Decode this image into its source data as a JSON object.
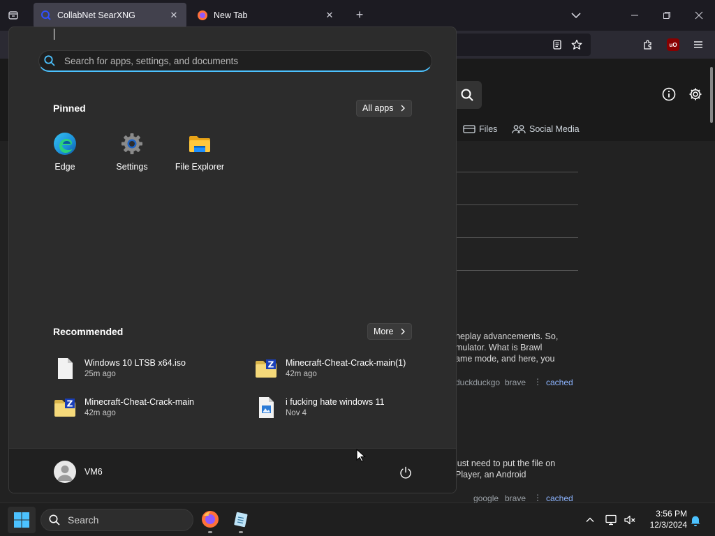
{
  "browser": {
    "tabs": [
      {
        "title": "CollabNet SearXNG",
        "active": true
      },
      {
        "title": "New Tab",
        "active": false
      }
    ]
  },
  "webpage": {
    "categories": [
      {
        "label": "Files",
        "icon": "files-icon"
      },
      {
        "label": "Social Media",
        "icon": "social-media-icon"
      }
    ],
    "results": [
      {
        "snippet": [
          "neplay advancements. So,",
          "mulator. What is Brawl",
          "ame mode, and here, you"
        ],
        "engines": [
          "duckduckgo",
          "brave"
        ],
        "cached": "cached"
      },
      {
        "snippet": [
          "just need to put the file on",
          "Player, an Android"
        ],
        "engines": [
          "google",
          "brave"
        ],
        "cached": "cached"
      }
    ]
  },
  "start_menu": {
    "search_placeholder": "Search for apps, settings, and documents",
    "pinned_title": "Pinned",
    "all_apps_label": "All apps",
    "pinned": [
      {
        "label": "Edge",
        "icon": "edge-icon"
      },
      {
        "label": "Settings",
        "icon": "settings-gear-icon"
      },
      {
        "label": "File Explorer",
        "icon": "folder-icon"
      }
    ],
    "recommended_title": "Recommended",
    "more_label": "More",
    "recommended": [
      {
        "name": "Windows 10 LTSB x64.iso",
        "time": "25m ago",
        "icon": "file-icon"
      },
      {
        "name": "Minecraft-Cheat-Crack-main(1)",
        "time": "42m ago",
        "icon": "zip-folder-icon"
      },
      {
        "name": "Minecraft-Cheat-Crack-main",
        "time": "42m ago",
        "icon": "zip-folder-icon"
      },
      {
        "name": "i fucking hate windows 11",
        "time": "Nov 4",
        "icon": "image-file-icon"
      }
    ],
    "user_name": "VM6"
  },
  "taskbar": {
    "search_label": "Search",
    "time": "3:56 PM",
    "date": "12/3/2024"
  },
  "colors": {
    "accent": "#4cc2ff",
    "link": "#8cb4ff",
    "start_bg": "#2c2c2c",
    "taskbar_bg": "#1f1f1f"
  }
}
